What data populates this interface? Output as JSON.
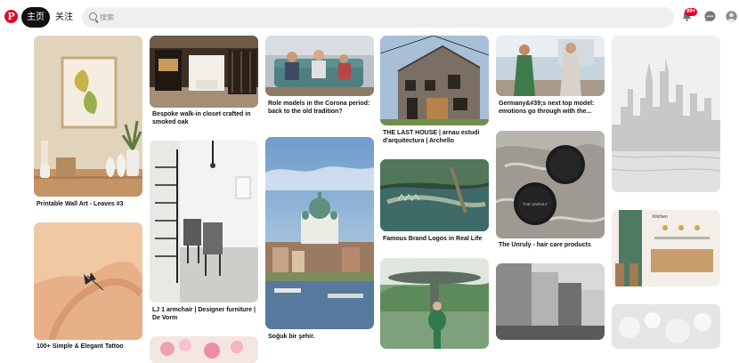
{
  "header": {
    "home_label": "主页",
    "follow_label": "关注",
    "search_placeholder": "搜索",
    "notification_count": "99+"
  },
  "pins": [
    {
      "caption": "Printable Wall Art - Leaves #3"
    },
    {
      "caption": "100+ Simple & Elegant Tattoo"
    },
    {
      "caption": "Bespoke walk-in closet crafted in smoked oak"
    },
    {
      "caption": "LJ 1 armchair | Designer furniture | De Vorm"
    },
    {
      "caption": "Role models in the Corona period: back to the old tradition?"
    },
    {
      "caption": "Soğuk bir şehir."
    },
    {
      "caption": "THE LAST HOUSE | arnau estudi d'arquitectura | Archello"
    },
    {
      "caption": "Famous Brand Logos in Real Life"
    },
    {
      "caption": "Germany&#39;s next top model: emotions go through with the..."
    },
    {
      "caption": "The Unruly - hair care products"
    }
  ],
  "product_label": "THE UNRULY",
  "kitchen_label": "Kitchen",
  "colors": {
    "brand": "#e60023",
    "active_nav": "#111111",
    "search_bg": "#efefef"
  }
}
